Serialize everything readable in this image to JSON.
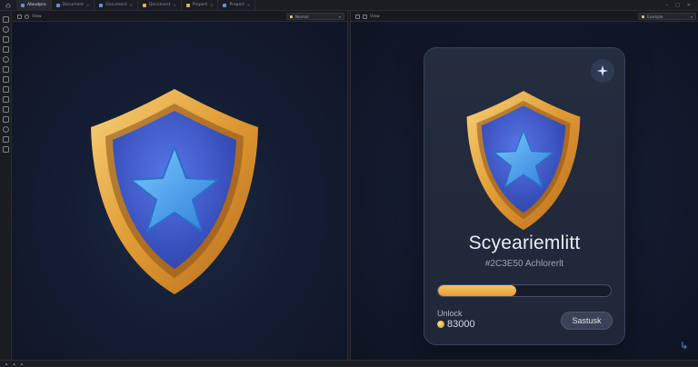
{
  "window": {
    "app_tab": "Aboutpro",
    "tabs": [
      {
        "label": "Document",
        "active": true
      },
      {
        "label": "Document",
        "active": false
      },
      {
        "label": "Document",
        "active": false
      },
      {
        "label": "Propert",
        "active": false
      },
      {
        "label": "Propert",
        "active": false
      }
    ]
  },
  "left_pane": {
    "view_label": "View",
    "dropdown_value": "Normal"
  },
  "right_pane": {
    "view_label": "View",
    "dropdown_value": "Example"
  },
  "card": {
    "title": "Scyeariemlitt",
    "subtitle": "#2C3E50  Achlorerlt",
    "progress_fraction": 0.45,
    "unlock_label": "Unlock",
    "price": "83000",
    "action_label": "Sastusk"
  },
  "colors": {
    "shield_gold": "#E5A23C",
    "shield_blue": "#3B5FD6",
    "star_blue": "#4DA6F2",
    "progress_gold": "#F0B24E",
    "background": "#121A2E"
  },
  "icons": {
    "corner_button": "sparkle-icon",
    "corner_mark": "arrow-down-right-icon",
    "coin": "coin-icon"
  }
}
